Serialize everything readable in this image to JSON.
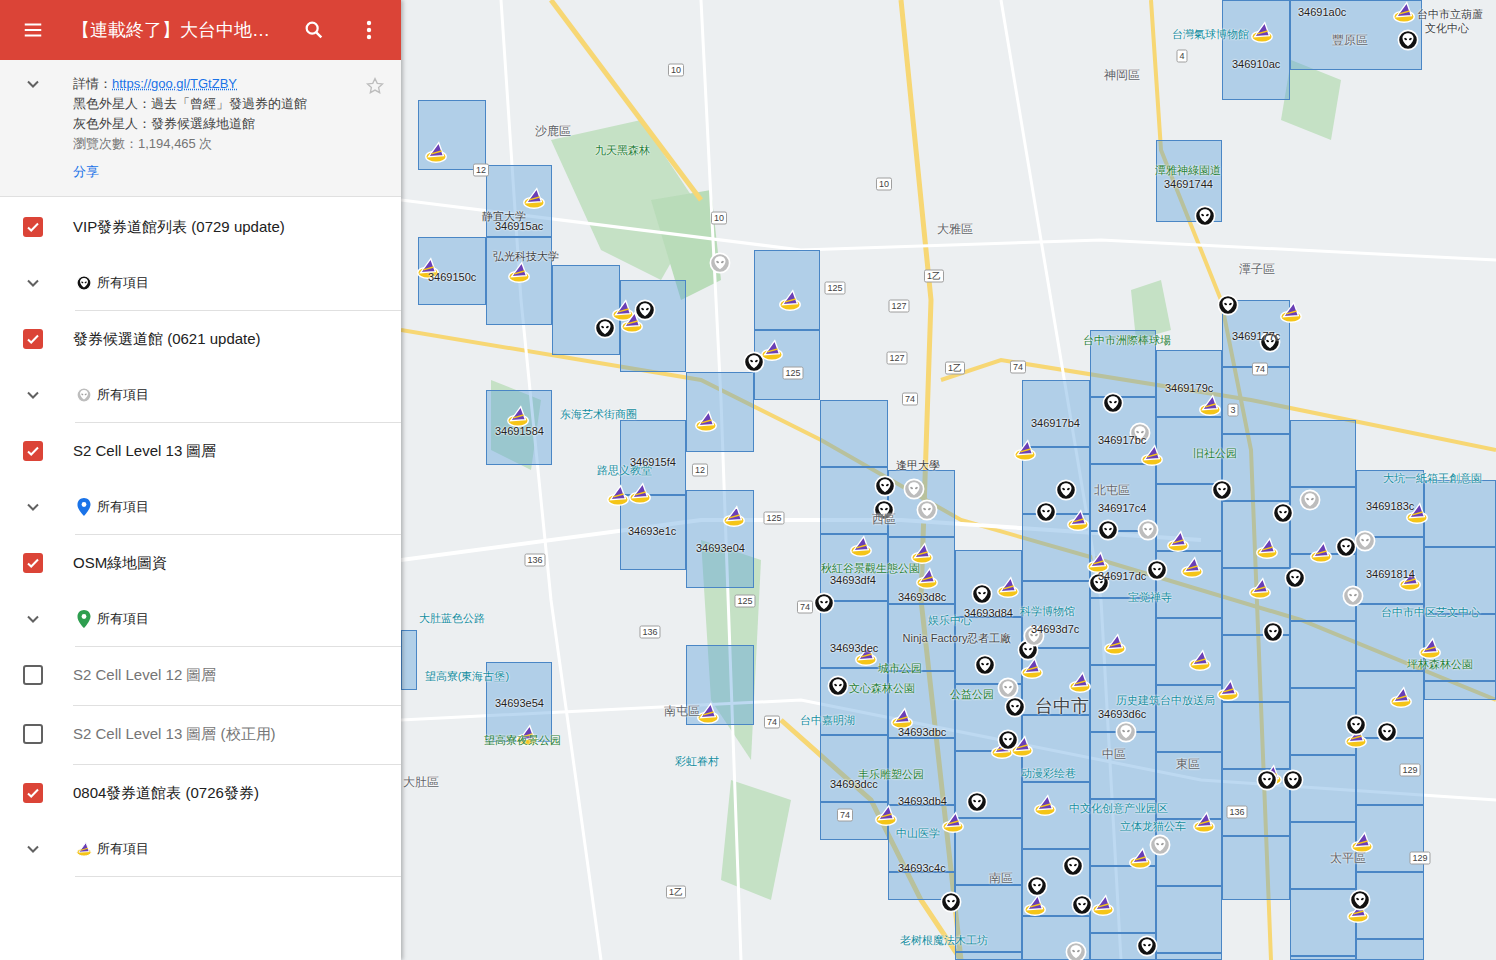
{
  "header": {
    "title": "【連載終了】大台中地…"
  },
  "info": {
    "detail_label": "詳情：",
    "link": "https://goo.gl/TGtZBY",
    "lines": [
      "黑色外星人：過去「曾經」發過券的道館",
      "灰色外星人：發券候選綠地道館"
    ],
    "views": "瀏覽次數：1,194,465 次",
    "share": "分享"
  },
  "layers": [
    {
      "name": "VIP發券道館列表 (0729 update)",
      "checked": true,
      "items_label": "所有項目",
      "kind": "black-alien"
    },
    {
      "name": "發券候選道館 (0621 update)",
      "checked": true,
      "items_label": "所有項目",
      "kind": "grey-alien"
    },
    {
      "name": "S2 Cell Level 13 圖層",
      "checked": true,
      "items_label": "所有項目",
      "kind": "blue-pin"
    },
    {
      "name": "OSM綠地圖資",
      "checked": true,
      "items_label": "所有項目",
      "kind": "green-pin"
    },
    {
      "name": "S2 Cell Level 12 圖層",
      "checked": false,
      "kind": "none"
    },
    {
      "name": "S2 Cell Level 13 圖層 (校正用)",
      "checked": false,
      "kind": "none"
    },
    {
      "name": "0804發券道館表 (0726發券)",
      "checked": true,
      "items_label": "所有項目",
      "kind": "hat"
    }
  ],
  "cell_labels": [
    "34691a0c",
    "346910ac",
    "34691744",
    "346915ac",
    "3469150c",
    "34691584",
    "346915f4",
    "34693e1c",
    "34693e04",
    "3469177c",
    "3469179c",
    "346917b4",
    "346917bc",
    "346917c4",
    "3469183c",
    "346917dc",
    "34691814",
    "34693df4",
    "34693d8c",
    "34693d84",
    "34693d7c",
    "34693dec",
    "34693d6c",
    "34693dbc",
    "34693dcc",
    "34693db4",
    "34693c4c",
    "34693e54"
  ],
  "places": [
    {
      "text": "沙鹿區",
      "kind": "district"
    },
    {
      "text": "神岡區",
      "kind": "district"
    },
    {
      "text": "大雅區",
      "kind": "district"
    },
    {
      "text": "潭子區",
      "kind": "district"
    },
    {
      "text": "北屯區",
      "kind": "district"
    },
    {
      "text": "南屯區",
      "kind": "district"
    },
    {
      "text": "中區",
      "kind": "district"
    },
    {
      "text": "東區",
      "kind": "district"
    },
    {
      "text": "南區",
      "kind": "district"
    },
    {
      "text": "大肚區",
      "kind": "district"
    },
    {
      "text": "太平區",
      "kind": "district"
    },
    {
      "text": "豐原區",
      "kind": "district"
    },
    {
      "text": "西區",
      "kind": "district"
    },
    {
      "text": "台中市",
      "kind": "city"
    },
    {
      "text": "九天黑森林",
      "kind": "green"
    },
    {
      "text": "潭雅神綠園道",
      "kind": "green"
    },
    {
      "text": "台中市洲際棒球場",
      "kind": "green"
    },
    {
      "text": "旧社公园",
      "kind": "green"
    },
    {
      "text": "秋紅谷景觀生態公園",
      "kind": "green"
    },
    {
      "text": "文心森林公園",
      "kind": "green"
    },
    {
      "text": "城市公园",
      "kind": "green"
    },
    {
      "text": "坪林森林公園",
      "kind": "green"
    },
    {
      "text": "丰乐雕塑公园",
      "kind": "green"
    },
    {
      "text": "公益公园",
      "kind": "green"
    },
    {
      "text": "望高寮夜景公园",
      "kind": "green"
    },
    {
      "text": "台灣氣球博物館",
      "kind": "teal"
    },
    {
      "text": "东海艺术街商圈",
      "kind": "teal"
    },
    {
      "text": "路思义教堂",
      "kind": "teal"
    },
    {
      "text": "望高寮(東海古堡)",
      "kind": "teal"
    },
    {
      "text": "大肚蓝色公路",
      "kind": "teal"
    },
    {
      "text": "科学博物馆",
      "kind": "teal"
    },
    {
      "text": "历史建筑台中放送局",
      "kind": "teal"
    },
    {
      "text": "中文化创意产业园区",
      "kind": "teal"
    },
    {
      "text": "立体龙猫公车",
      "kind": "teal"
    },
    {
      "text": "台中市中区艺文中心",
      "kind": "teal"
    },
    {
      "text": "动漫彩绘巷",
      "kind": "teal"
    },
    {
      "text": "彩虹眷村",
      "kind": "teal"
    },
    {
      "text": "台中嘉明湖",
      "kind": "teal"
    },
    {
      "text": "老树根魔法木工坊",
      "kind": "teal"
    },
    {
      "text": "大坑一紙箱王創意園",
      "kind": "teal"
    },
    {
      "text": "中山医学",
      "kind": "teal"
    },
    {
      "text": "宝觉禅寺",
      "kind": "teal"
    },
    {
      "text": "娱乐中心",
      "kind": "teal"
    },
    {
      "text": "逢甲大學",
      "kind": "poi"
    },
    {
      "text": "静宜大学",
      "kind": "poi"
    },
    {
      "text": "弘光科技大学",
      "kind": "poi"
    },
    {
      "text": "Ninja Factory忍者工廠",
      "kind": "poi"
    },
    {
      "text": "台中市立葫蘆",
      "kind": "poi"
    },
    {
      "text": "文化中心",
      "kind": "poi"
    }
  ],
  "roads": [
    "10",
    "10",
    "10",
    "12",
    "12",
    "125",
    "125",
    "125",
    "125",
    "127",
    "127",
    "74",
    "74",
    "74",
    "74",
    "74",
    "74",
    "136",
    "136",
    "136",
    "129",
    "129",
    "1乙",
    "1乙",
    "1乙",
    "3",
    "4"
  ],
  "markers": [
    {
      "kind": "hat"
    },
    {
      "kind": "hat"
    },
    {
      "kind": "hat"
    },
    {
      "kind": "hat"
    },
    {
      "kind": "hat"
    },
    {
      "kind": "hat"
    },
    {
      "kind": "hat"
    },
    {
      "kind": "hat"
    },
    {
      "kind": "hat"
    },
    {
      "kind": "hat"
    },
    {
      "kind": "hat"
    },
    {
      "kind": "hat"
    },
    {
      "kind": "hat"
    },
    {
      "kind": "hat"
    },
    {
      "kind": "hat"
    },
    {
      "kind": "hat"
    },
    {
      "kind": "hat"
    },
    {
      "kind": "hat"
    },
    {
      "kind": "hat"
    },
    {
      "kind": "hat"
    },
    {
      "kind": "hat"
    },
    {
      "kind": "hat"
    },
    {
      "kind": "hat"
    },
    {
      "kind": "hat"
    },
    {
      "kind": "hat"
    },
    {
      "kind": "hat"
    },
    {
      "kind": "hat"
    },
    {
      "kind": "hat"
    },
    {
      "kind": "hat"
    },
    {
      "kind": "hat"
    },
    {
      "kind": "hat"
    },
    {
      "kind": "hat"
    },
    {
      "kind": "hat"
    },
    {
      "kind": "hat"
    },
    {
      "kind": "hat"
    },
    {
      "kind": "hat"
    },
    {
      "kind": "hat"
    },
    {
      "kind": "hat"
    },
    {
      "kind": "hat"
    },
    {
      "kind": "hat"
    },
    {
      "kind": "hat"
    },
    {
      "kind": "hat"
    },
    {
      "kind": "hat"
    },
    {
      "kind": "hat"
    },
    {
      "kind": "hat"
    },
    {
      "kind": "hat"
    },
    {
      "kind": "hat"
    },
    {
      "kind": "hat"
    },
    {
      "kind": "hat"
    },
    {
      "kind": "hat"
    },
    {
      "kind": "hat"
    },
    {
      "kind": "hat"
    },
    {
      "kind": "hat"
    },
    {
      "kind": "hat"
    },
    {
      "kind": "hat"
    },
    {
      "kind": "hat"
    },
    {
      "kind": "black"
    },
    {
      "kind": "black"
    },
    {
      "kind": "black"
    },
    {
      "kind": "black"
    },
    {
      "kind": "black"
    },
    {
      "kind": "black"
    },
    {
      "kind": "black"
    },
    {
      "kind": "black"
    },
    {
      "kind": "black"
    },
    {
      "kind": "black"
    },
    {
      "kind": "black"
    },
    {
      "kind": "black"
    },
    {
      "kind": "black"
    },
    {
      "kind": "black"
    },
    {
      "kind": "black"
    },
    {
      "kind": "black"
    },
    {
      "kind": "black"
    },
    {
      "kind": "black"
    },
    {
      "kind": "black"
    },
    {
      "kind": "black"
    },
    {
      "kind": "black"
    },
    {
      "kind": "black"
    },
    {
      "kind": "black"
    },
    {
      "kind": "black"
    },
    {
      "kind": "black"
    },
    {
      "kind": "black"
    },
    {
      "kind": "black"
    },
    {
      "kind": "black"
    },
    {
      "kind": "black"
    },
    {
      "kind": "black"
    },
    {
      "kind": "black"
    },
    {
      "kind": "black"
    },
    {
      "kind": "black"
    },
    {
      "kind": "black"
    },
    {
      "kind": "black"
    },
    {
      "kind": "black"
    },
    {
      "kind": "black"
    },
    {
      "kind": "black"
    },
    {
      "kind": "grey"
    },
    {
      "kind": "grey"
    },
    {
      "kind": "grey"
    },
    {
      "kind": "grey"
    },
    {
      "kind": "grey"
    },
    {
      "kind": "grey"
    },
    {
      "kind": "grey"
    },
    {
      "kind": "grey"
    },
    {
      "kind": "grey"
    },
    {
      "kind": "grey"
    },
    {
      "kind": "grey"
    },
    {
      "kind": "grey"
    },
    {
      "kind": "grey"
    }
  ]
}
